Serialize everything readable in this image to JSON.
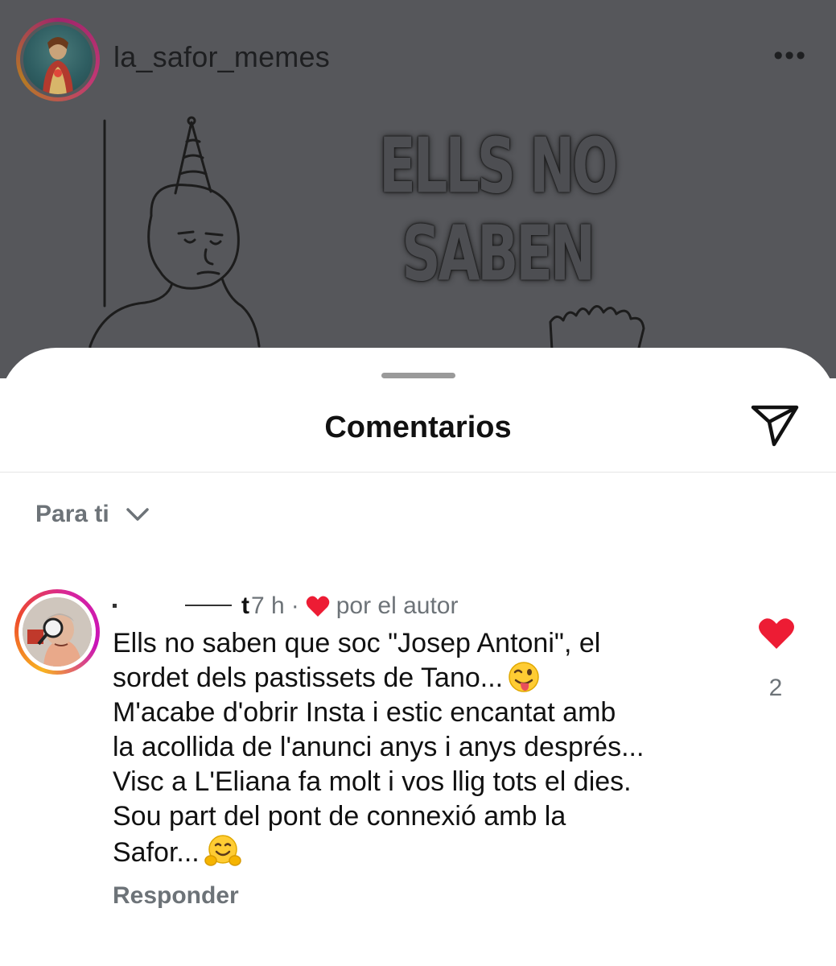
{
  "post": {
    "username": "la_safor_memes",
    "more_label": "•••",
    "meme_caption": "ELLS NO SABEN"
  },
  "sheet": {
    "title": "Comentarios",
    "share_icon": "paper-plane-icon",
    "filter_label": "Para ti",
    "filter_icon": "chevron-down-icon"
  },
  "comment": {
    "username_tail": "t",
    "time": "7 h",
    "separator": "·",
    "liked_by": "por el autor",
    "lines": [
      "Ells no saben que soc \"Josep Antoni\", el",
      "sordet dels pastissets de Tano...",
      "M'acabe d'obrir Insta i estic encantat amb",
      "la acollida de l'anunci anys i anys després...",
      "Visc a L'Eliana fa molt i vos llig tots el dies.",
      "Sou part del pont de connexió amb la",
      "Safor..."
    ],
    "reply_label": "Responder",
    "like_count": "2",
    "colors": {
      "heart": "#ed1c34",
      "muted_text": "#6d7378"
    }
  }
}
